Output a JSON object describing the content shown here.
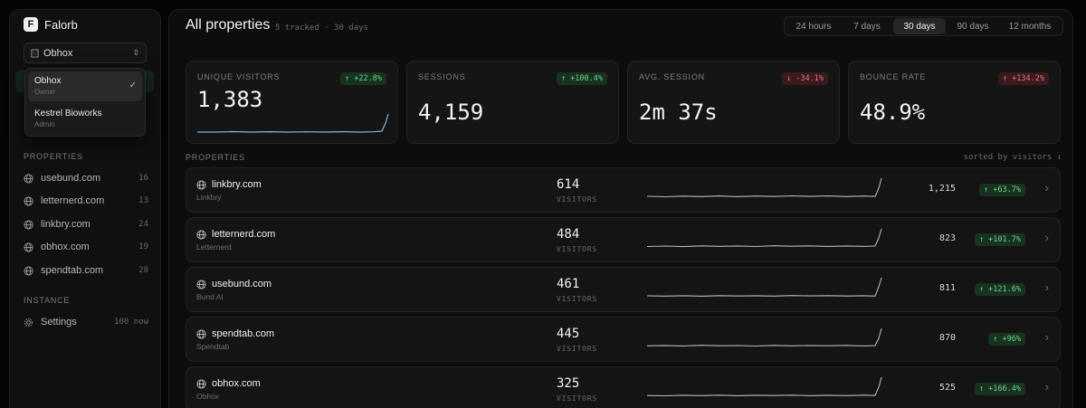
{
  "brand": {
    "logo_letter": "F",
    "name": "Falorb"
  },
  "org_select": {
    "value": "Obhox"
  },
  "org_dropdown": [
    {
      "name": "Obhox",
      "role": "Owner",
      "selected": true
    },
    {
      "name": "Kestrel Bioworks",
      "role": "Admin",
      "selected": false
    }
  ],
  "sidebar": {
    "properties_label": "PROPERTIES",
    "items": [
      {
        "label": "usebund.com",
        "count": "16"
      },
      {
        "label": "letternerd.com",
        "count": "13"
      },
      {
        "label": "linkbry.com",
        "count": "24"
      },
      {
        "label": "obhox.com",
        "count": "19"
      },
      {
        "label": "spendtab.com",
        "count": "28"
      }
    ],
    "instance_label": "INSTANCE",
    "settings": {
      "label": "Settings",
      "meta": "100 now"
    }
  },
  "header": {
    "title": "All properties",
    "subtitle": "5 tracked · 30 days"
  },
  "ranges": [
    {
      "label": "24 hours",
      "active": false
    },
    {
      "label": "7 days",
      "active": false
    },
    {
      "label": "30 days",
      "active": true
    },
    {
      "label": "90 days",
      "active": false
    },
    {
      "label": "12 months",
      "active": false
    }
  ],
  "stats": [
    {
      "label": "UNIQUE VISITORS",
      "value": "1,383",
      "delta": "↑ +22.8%",
      "trend": "up"
    },
    {
      "label": "SESSIONS",
      "value": "4,159",
      "delta": "↑ +100.4%",
      "trend": "up"
    },
    {
      "label": "AVG. SESSION",
      "value": "2m 37s",
      "delta": "↓ -34.1%",
      "trend": "down"
    },
    {
      "label": "BOUNCE RATE",
      "value": "48.9%",
      "delta": "↑ +134.2%",
      "trend": "down"
    }
  ],
  "properties_section": {
    "label": "PROPERTIES",
    "sort": "sorted by visitors ↓"
  },
  "properties": [
    {
      "domain": "linkbry.com",
      "name": "Linkbry",
      "visitors": "614",
      "visitors_label": "VISITORS",
      "total": "1,215",
      "delta": "↑ +63.7%"
    },
    {
      "domain": "letternerd.com",
      "name": "Letternerd",
      "visitors": "484",
      "visitors_label": "VISITORS",
      "total": "823",
      "delta": "↑ +101.7%"
    },
    {
      "domain": "usebund.com",
      "name": "Bund AI",
      "visitors": "461",
      "visitors_label": "VISITORS",
      "total": "811",
      "delta": "↑ +121.6%"
    },
    {
      "domain": "spendtab.com",
      "name": "Spendtab",
      "visitors": "445",
      "visitors_label": "VISITORS",
      "total": "870",
      "delta": "↑ +96%"
    },
    {
      "domain": "obhox.com",
      "name": "Obhox",
      "visitors": "325",
      "visitors_label": "VISITORS",
      "total": "525",
      "delta": "↑ +166.4%"
    }
  ],
  "colors": {
    "accent_line": "#7fb6d6",
    "up": "#6fd48d",
    "down": "#e07a80"
  },
  "icons": {
    "globe": "globe-icon",
    "settings": "gear-icon",
    "org": "building-icon"
  }
}
